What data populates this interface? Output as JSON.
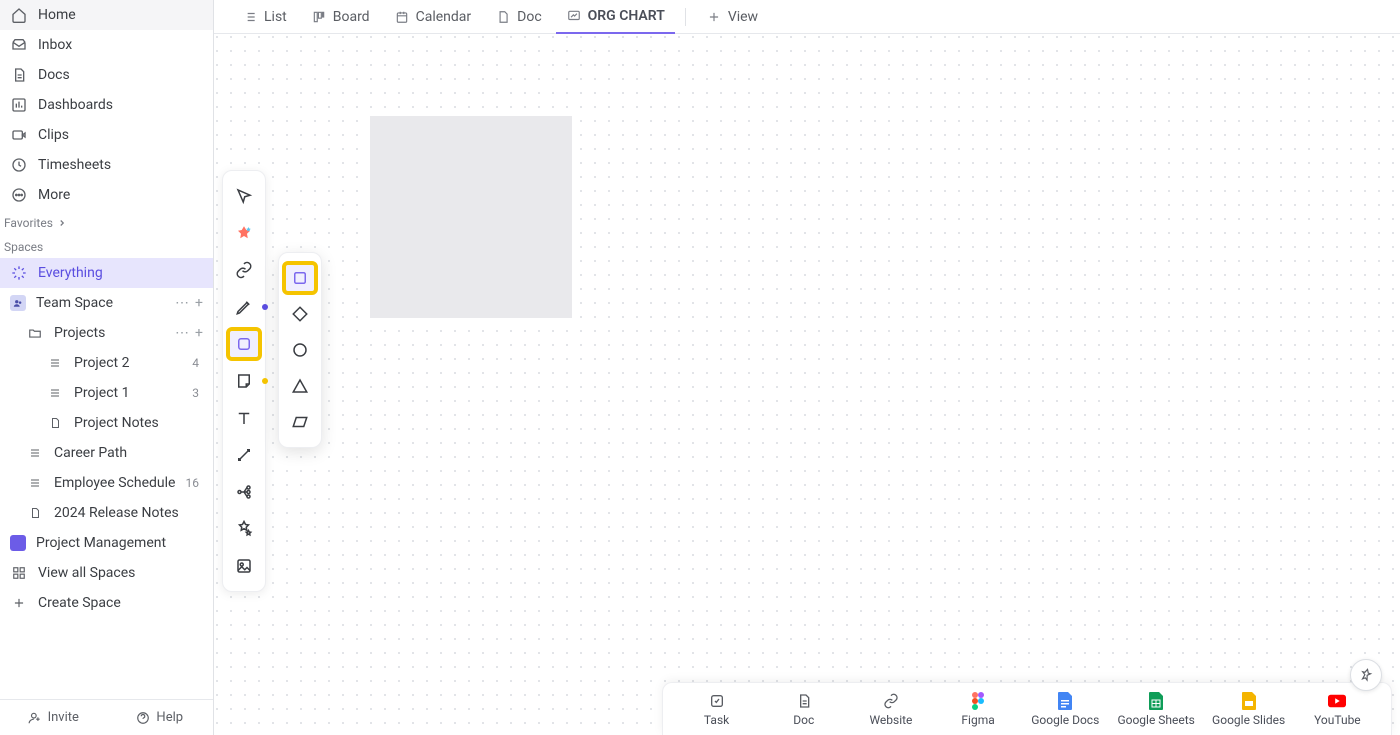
{
  "sidebar": {
    "nav": [
      {
        "label": "Home",
        "icon": "home"
      },
      {
        "label": "Inbox",
        "icon": "inbox"
      },
      {
        "label": "Docs",
        "icon": "doc"
      },
      {
        "label": "Dashboards",
        "icon": "dash"
      },
      {
        "label": "Clips",
        "icon": "clips"
      },
      {
        "label": "Timesheets",
        "icon": "time"
      },
      {
        "label": "More",
        "icon": "more"
      }
    ],
    "favorites_label": "Favorites",
    "spaces_label": "Spaces",
    "everything_label": "Everything",
    "team_space_label": "Team Space",
    "projects_label": "Projects",
    "projects_children": [
      {
        "label": "Project 2",
        "count": "4"
      },
      {
        "label": "Project 1",
        "count": "3"
      },
      {
        "label": "Project Notes",
        "count": ""
      }
    ],
    "more_items": [
      {
        "label": "Career Path",
        "count": ""
      },
      {
        "label": "Employee Schedule",
        "count": "16"
      },
      {
        "label": "2024 Release Notes",
        "count": ""
      }
    ],
    "pm_label": "Project Management",
    "view_all_label": "View all Spaces",
    "create_space_label": "Create Space",
    "invite_label": "Invite",
    "help_label": "Help"
  },
  "viewtabs": [
    {
      "label": "List"
    },
    {
      "label": "Board"
    },
    {
      "label": "Calendar"
    },
    {
      "label": "Doc"
    },
    {
      "label": "ORG CHART",
      "active": true
    }
  ],
  "add_view_label": "View",
  "appbar": [
    {
      "label": "Task"
    },
    {
      "label": "Doc"
    },
    {
      "label": "Website"
    },
    {
      "label": "Figma"
    },
    {
      "label": "Google Docs"
    },
    {
      "label": "Google Sheets"
    },
    {
      "label": "Google Slides"
    },
    {
      "label": "YouTube"
    }
  ]
}
